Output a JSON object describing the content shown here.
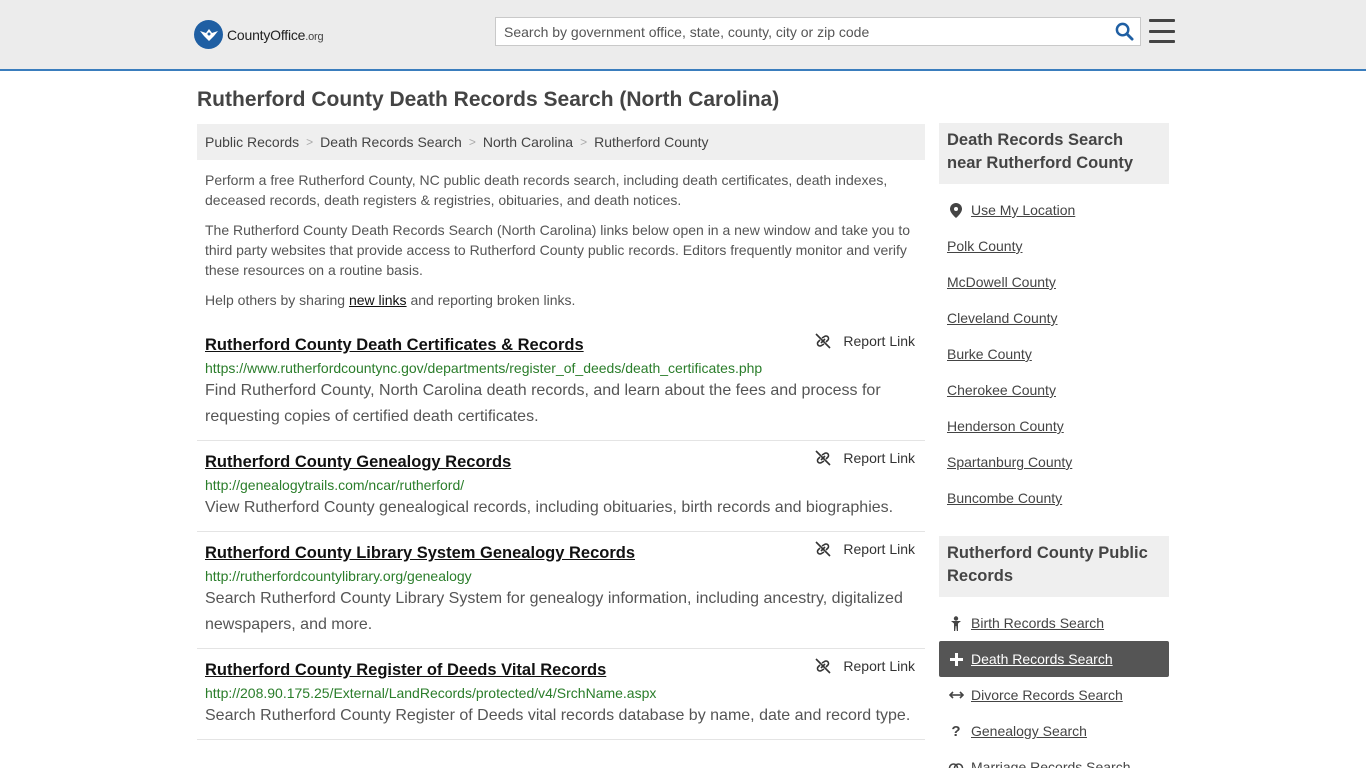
{
  "header": {
    "logo_main": "CountyOffice",
    "logo_tld": ".org",
    "search_placeholder": "Search by government office, state, county, city or zip code"
  },
  "page": {
    "title": "Rutherford County Death Records Search (North Carolina)"
  },
  "breadcrumb": [
    "Public Records",
    "Death Records Search",
    "North Carolina",
    "Rutherford County"
  ],
  "intro": {
    "p1": "Perform a free Rutherford County, NC public death records search, including death certificates, death indexes, deceased records, death registers & registries, obituaries, and death notices.",
    "p2": "The Rutherford County Death Records Search (North Carolina) links below open in a new window and take you to third party websites that provide access to Rutherford County public records. Editors frequently monitor and verify these resources on a routine basis.",
    "p3_before": "Help others by sharing ",
    "p3_link": "new links",
    "p3_after": " and reporting broken links."
  },
  "report_label": "Report Link",
  "results": [
    {
      "title": "Rutherford County Death Certificates & Records",
      "url": "https://www.rutherfordcountync.gov/departments/register_of_deeds/death_certificates.php",
      "desc": "Find Rutherford County, North Carolina death records, and learn about the fees and process for requesting copies of certified death certificates."
    },
    {
      "title": "Rutherford County Genealogy Records",
      "url": "http://genealogytrails.com/ncar/rutherford/",
      "desc": "View Rutherford County genealogical records, including obituaries, birth records and biographies."
    },
    {
      "title": "Rutherford County Library System Genealogy Records",
      "url": "http://rutherfordcountylibrary.org/genealogy",
      "desc": "Search Rutherford County Library System for genealogy information, including ancestry, digitalized newspapers, and more."
    },
    {
      "title": "Rutherford County Register of Deeds Vital Records",
      "url": "http://208.90.175.25/External/LandRecords/protected/v4/SrchName.aspx",
      "desc": "Search Rutherford County Register of Deeds vital records database by name, date and record type."
    }
  ],
  "sidebar": {
    "nearby_heading": "Death Records Search near Rutherford County",
    "use_location": "Use My Location",
    "nearby": [
      "Polk County",
      "McDowell County",
      "Cleveland County",
      "Burke County",
      "Cherokee County",
      "Henderson County",
      "Spartanburg County",
      "Buncombe County"
    ],
    "public_heading": "Rutherford County Public Records",
    "public_links": [
      {
        "label": "Birth Records Search",
        "icon": "person-icon"
      },
      {
        "label": "Death Records Search",
        "icon": "plus-icon"
      },
      {
        "label": "Divorce Records Search",
        "icon": "split-arrows-icon"
      },
      {
        "label": "Genealogy Search",
        "icon": "question-icon"
      },
      {
        "label": "Marriage Records Search",
        "icon": "rings-icon"
      }
    ]
  }
}
